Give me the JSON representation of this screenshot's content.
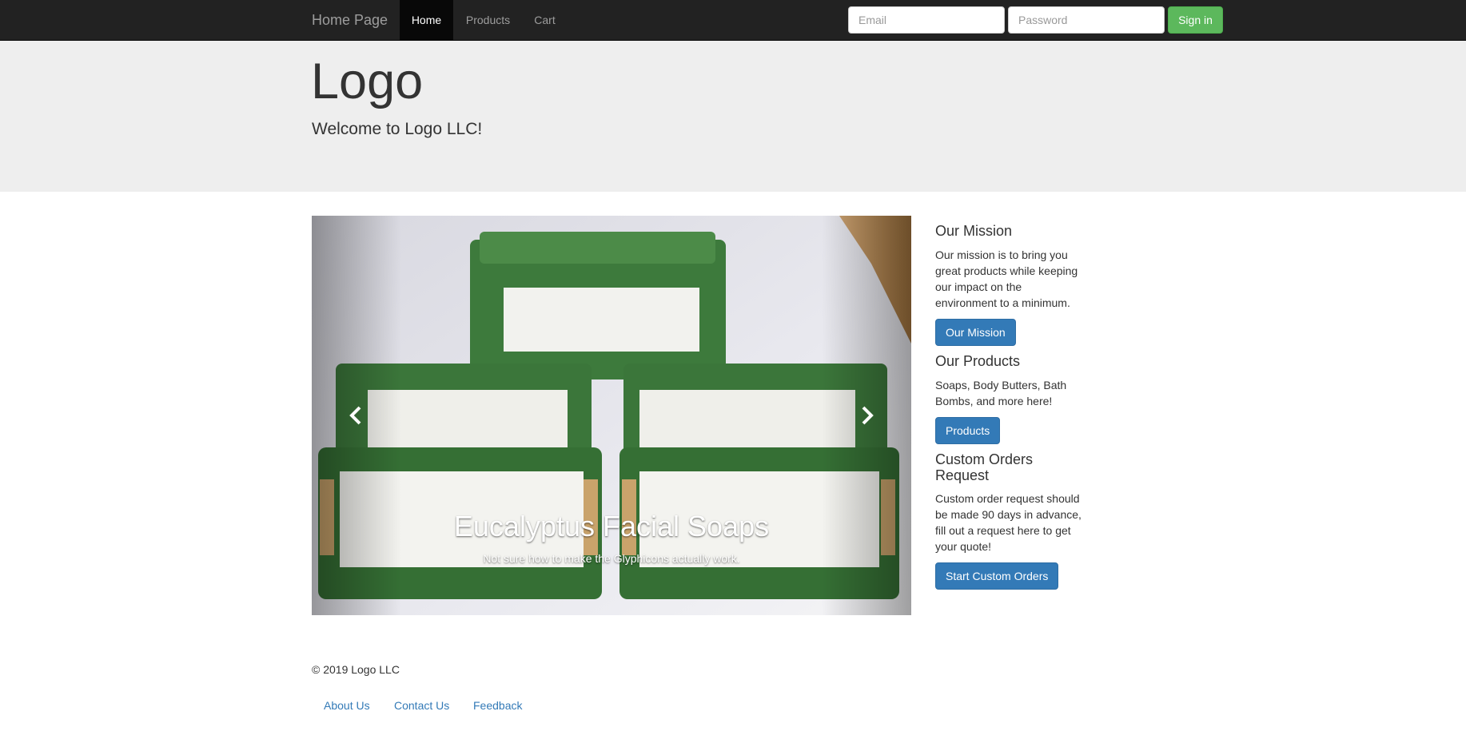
{
  "navbar": {
    "brand": "Home Page",
    "links": [
      {
        "label": "Home",
        "active": true
      },
      {
        "label": "Products",
        "active": false
      },
      {
        "label": "Cart",
        "active": false
      }
    ],
    "email_placeholder": "Email",
    "password_placeholder": "Password",
    "signin_label": "Sign in"
  },
  "jumbotron": {
    "title": "Logo",
    "subtitle": "Welcome to Logo LLC!"
  },
  "carousel": {
    "caption_title": "Eucalyptus Facial Soaps",
    "caption_text": "Not sure how to make the Glyphicons actually work.",
    "prev_icon": "chevron-left-icon",
    "next_icon": "chevron-right-icon"
  },
  "sidebar": {
    "mission_heading": "Our Mission",
    "mission_text": "Our mission is to bring you great products while keeping our impact on the environment to a minimum.",
    "mission_button": "Our Mission",
    "products_heading": "Our Products",
    "products_text": "Soaps, Body Butters, Bath Bombs, and more here!",
    "products_button": "Products",
    "custom_heading": "Custom Orders Request",
    "custom_text": "Custom order request should be made 90 days in advance, fill out a request here to get your quote!",
    "custom_button": "Start Custom Orders"
  },
  "footer": {
    "copyright": "© 2019 Logo LLC",
    "links": [
      "About Us",
      "Contact Us",
      "Feedback"
    ]
  },
  "colors": {
    "navbar_bg": "#222222",
    "primary_button": "#337ab7",
    "success_button": "#5cb85c",
    "jumbotron_bg": "#eeeeee",
    "soap_green": "#3f7a3d"
  }
}
